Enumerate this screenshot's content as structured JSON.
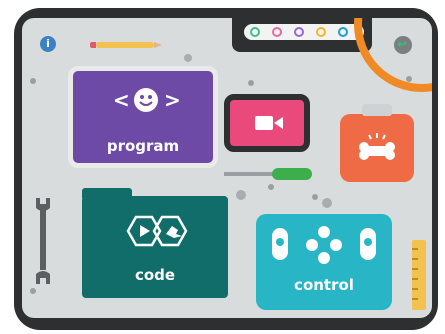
{
  "colors": {
    "frame": "#2d2f30",
    "screen": "#d9dcdd",
    "program_tile": "#6d4aa6",
    "program_tile_edge": "#5a3b8f",
    "video_tile": "#e94a7b",
    "bone_tile": "#ef6b45",
    "code_tile": "#116d6a",
    "control_tile": "#28b6c6",
    "accent_orange": "#f08a24"
  },
  "tiles": {
    "program": {
      "label": "program",
      "icon": "smiley-code-icon"
    },
    "video": {
      "icon": "video-camera-icon"
    },
    "bone": {
      "icon": "dog-bone-icon"
    },
    "code": {
      "label": "code",
      "icon": "play-bird-code-icon"
    },
    "control": {
      "label": "control",
      "icon": "gamepad-icon"
    }
  },
  "toolbar": {
    "info_icon": "info-icon",
    "back_icon": "back-arrow-icon",
    "color_dots": [
      "#3fbf8a",
      "#e96aa0",
      "#8e6bd6",
      "#f2b72f",
      "#1f9bd7"
    ]
  }
}
